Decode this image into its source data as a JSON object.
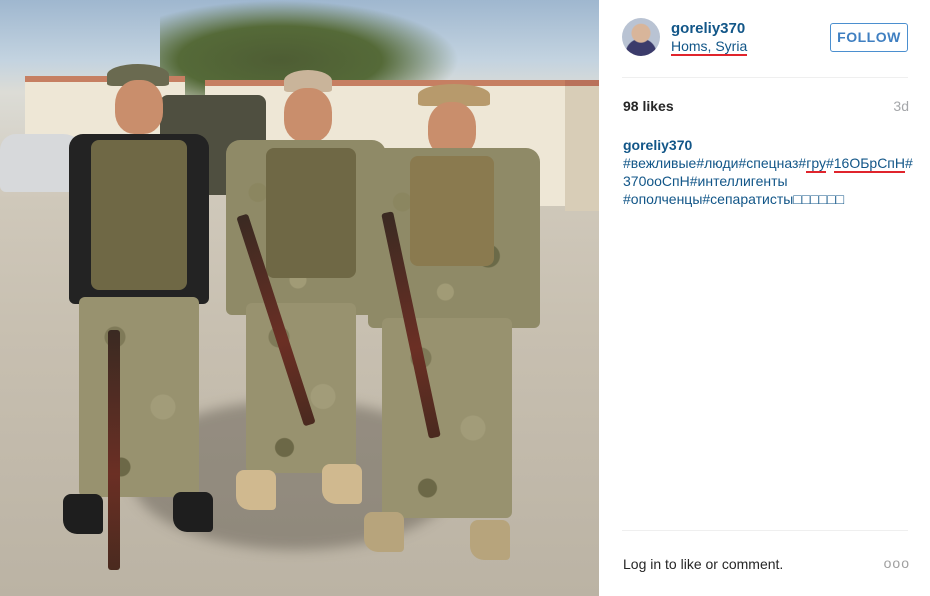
{
  "post": {
    "username": "goreliy370",
    "location": "Homs, Syria",
    "follow_label": "FOLLOW",
    "likes": "98 likes",
    "age": "3d"
  },
  "caption": {
    "user": "goreliy370",
    "tag_parts": [
      " #вежливые#люди#спецназ#",
      "г",
      "ру",
      "#",
      "16ОБрСпН",
      "#370ooСпН#интеллигенты #ополченцы#сепаратисты",
      "□□□□□□"
    ]
  },
  "footer": {
    "login_link": "Log in",
    "login_rest": " to like or comment.",
    "more_label": "ooo"
  },
  "icons": {
    "avatar": "user-avatar-icon",
    "more": "more-options-icon"
  },
  "colors": {
    "link": "#125688",
    "follow_border": "#4b8fcf",
    "annotation_underline": "#e0242c"
  }
}
